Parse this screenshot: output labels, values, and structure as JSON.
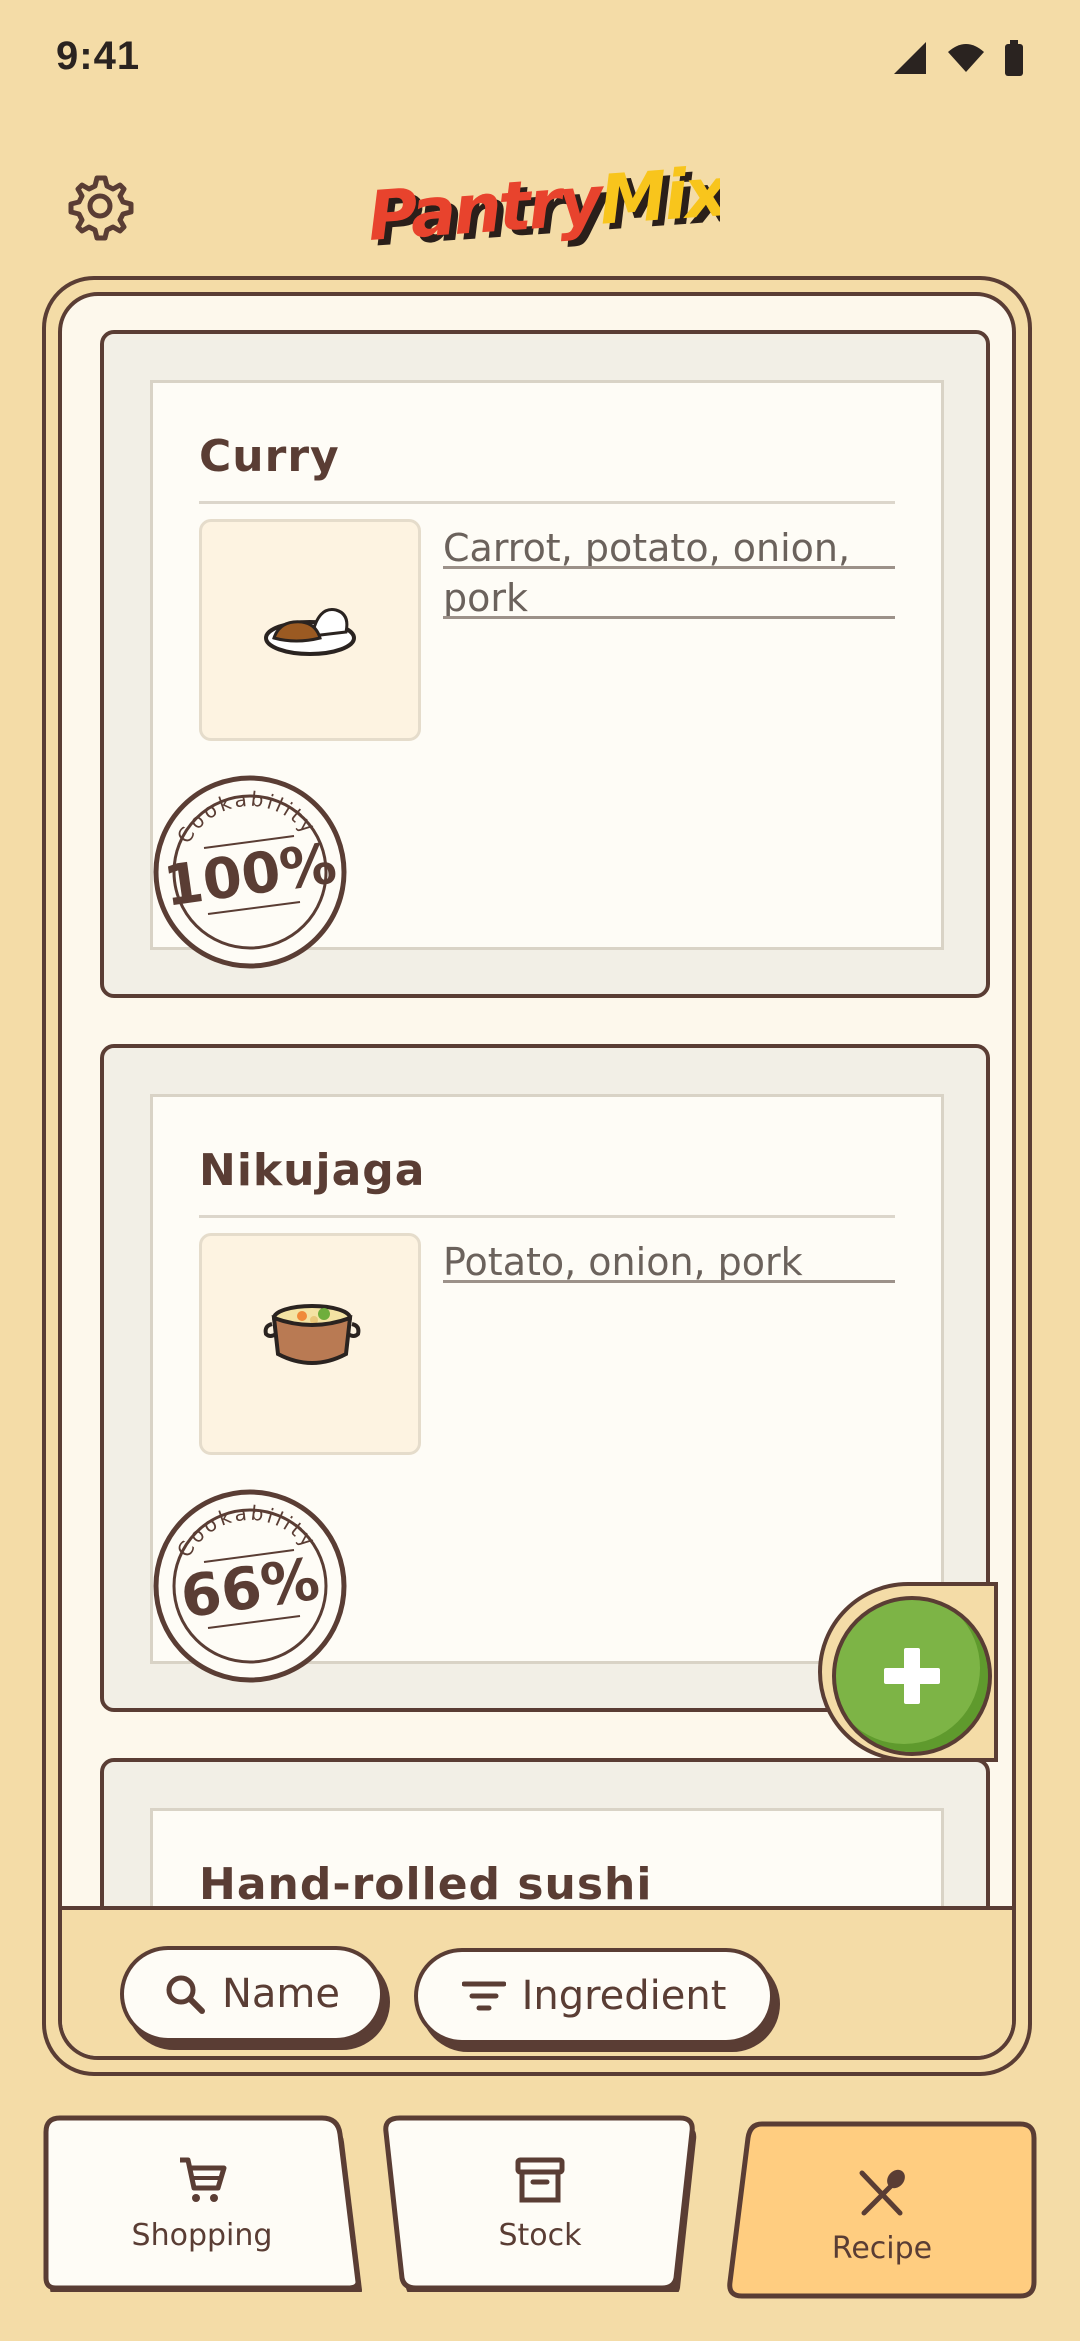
{
  "status_bar": {
    "time": "9:41"
  },
  "header": {
    "logo_text_a": "Pantry",
    "logo_text_b": "Mix"
  },
  "recipes": [
    {
      "name": "Curry",
      "ingredients_line1": "Carrot, potato, onion,",
      "ingredients_line2": "pork",
      "icon": "curry-rice-icon",
      "stamp_label": "Cookability",
      "cookability": "100%"
    },
    {
      "name": "Nikujaga",
      "ingredients_line1": "Potato, onion, pork",
      "ingredients_line2": "",
      "icon": "stew-pot-icon",
      "stamp_label": "Cookability",
      "cookability": "66%"
    },
    {
      "name": "Hand-rolled sushi"
    }
  ],
  "toolbar": {
    "name_button": "Name",
    "ingredient_button": "Ingredient"
  },
  "nav": {
    "shopping": "Shopping",
    "stock": "Stock",
    "recipe": "Recipe",
    "active": "Recipe"
  },
  "colors": {
    "background": "#f4dca7",
    "ink": "#5a3d34",
    "fab_green": "#7db446",
    "active_tab": "#ffcd80",
    "logo_red": "#e8432d",
    "logo_yellow": "#f8c51c"
  }
}
